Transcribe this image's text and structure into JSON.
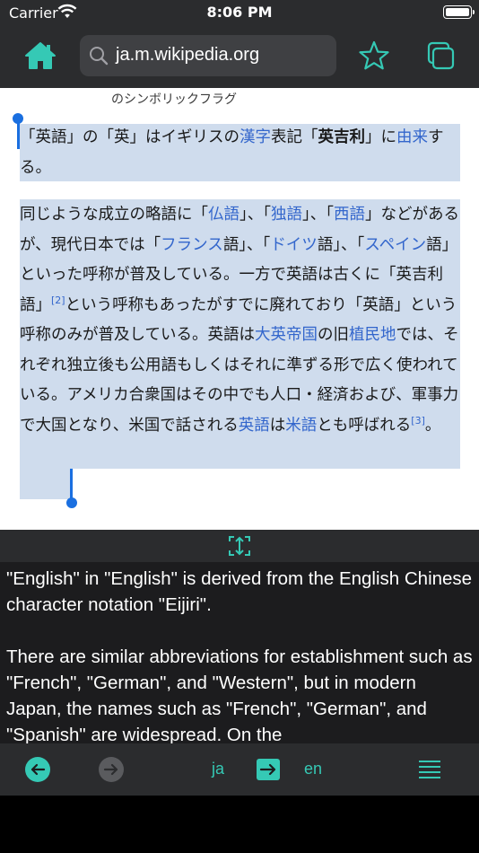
{
  "status": {
    "carrier": "Carrier",
    "time": "8:06 PM"
  },
  "toolbar": {
    "url": "ja.m.wikipedia.org"
  },
  "icons": {
    "home": "home-icon",
    "search": "search-icon",
    "bookmark": "star-icon",
    "tabs": "tabs-icon",
    "expand": "expand-icon",
    "back": "arrow-left-icon",
    "forward": "arrow-right-icon",
    "swap": "arrow-right-icon",
    "menu": "menu-icon"
  },
  "colors": {
    "accent": "#35c9b5",
    "selection": "#cfdced",
    "link": "#3366cc",
    "bar": "#2b2c2e"
  },
  "article": {
    "caption": "のシンボリックフラグ",
    "p1": {
      "t1": "「英語」の「英」はイギリスの",
      "link1": "漢字",
      "t2": "表記「",
      "bold1": "英吉利",
      "t3": "」に",
      "link2": "由来",
      "t4": "する。"
    },
    "p2": {
      "t1": "同じような成立の略語に「",
      "link1": "仏語",
      "t2": "」、「",
      "link2": "独語",
      "t3": "」、「",
      "link3": "西語",
      "t4": "」などがあるが、現代日本では「",
      "link4": "フランス",
      "t5": "語」、「",
      "link5": "ドイツ",
      "t6": "語」、「",
      "link6": "スペイン",
      "t7": "語」といった呼称が普及している。一方で英語は古くに「英吉利語」",
      "ref1": "[2]",
      "t8": "という呼称もあったがすでに廃れており「英語」という呼称のみが普及している。英語は",
      "link7": "大英帝国",
      "t9": "の旧",
      "link8": "植民地",
      "t10": "では、それぞれ独立後も公用語もしくはそれに準ずる形で広く使われている。アメリカ合衆国はその中でも人口・経済および、軍事力で大国となり、米国で話される",
      "link9": "英語",
      "t11": "は",
      "link10": "米語",
      "t12": "とも呼ばれる",
      "ref2": "[3]",
      "t13": "。"
    }
  },
  "translation": {
    "text": "\"English\" in \"English\" is derived from the English Chinese character notation \"Eijiri\".\n\nThere are similar abbreviations for establishment such as \"French\", \"German\", and \"Western\", but in modern Japan, the names such as \"French\", \"German\", and \"Spanish\" are widespread. On the"
  },
  "bottom": {
    "source_lang": "ja",
    "target_lang": "en"
  }
}
